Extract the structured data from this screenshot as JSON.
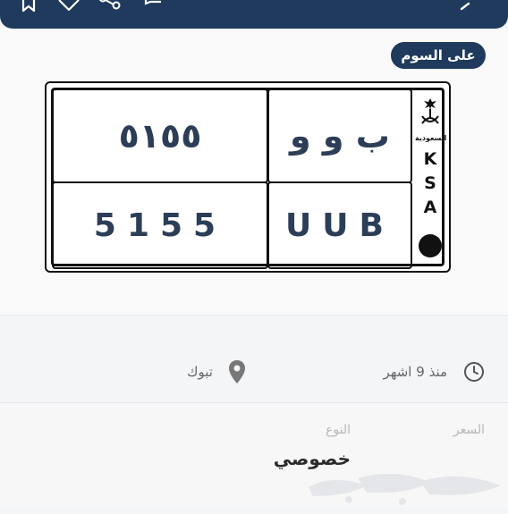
{
  "plate": {
    "arabic_letters": "ب و و",
    "arabic_numbers": "٥١٥٥",
    "latin_letters": "UUB",
    "latin_numbers": "5155",
    "country_word": "السعودية",
    "ksa_letters": [
      "K",
      "S",
      "A"
    ]
  },
  "meta": {
    "time_ago": "منذ 9 اشهر",
    "location": "تبوك"
  },
  "details": {
    "price_label": "السعر",
    "price_value": "على السوم",
    "type_label": "النوع",
    "type_value": "خصوصي"
  },
  "colors": {
    "brand_navy": "#1f3a5c",
    "plate_text": "#2c3e57"
  },
  "icons": {
    "header": [
      "bookmark-icon",
      "heart-icon",
      "share-icon",
      "chat-icon",
      "back-arrow-icon"
    ],
    "meta": [
      "clock-icon",
      "location-pin-icon"
    ]
  }
}
